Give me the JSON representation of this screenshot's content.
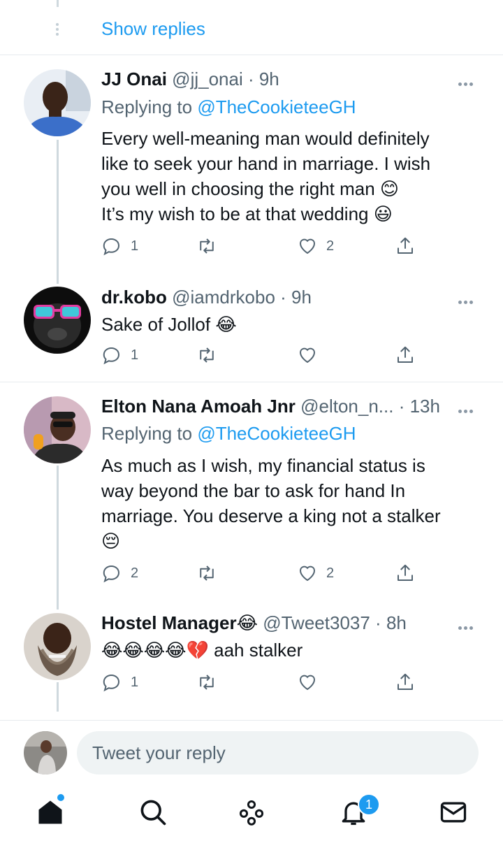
{
  "show_replies": "Show replies",
  "tweets": [
    {
      "name": "JJ Onai",
      "handle": "@jj_onai",
      "sep": " · ",
      "time": "9h",
      "replying_prefix": "Replying to ",
      "replying_to": "@TheCookieteeGH",
      "text_lines": [
        "Every well-meaning man would definitely",
        "like to seek your hand in marriage. I wish",
        "you well in choosing the right man 😊",
        "It’s my wish to be at that wedding 😃"
      ],
      "replies": "1",
      "retweets": "",
      "likes": "2"
    },
    {
      "name": "dr.kobo",
      "handle": "@iamdrkobo",
      "sep": " · ",
      "time": "9h",
      "text_lines": [
        "Sake of Jollof 😂"
      ],
      "replies": "1",
      "retweets": "",
      "likes": ""
    },
    {
      "name": "Elton Nana Amoah Jnr",
      "handle": "@elton_n...",
      "sep": " · ",
      "time": "13h",
      "replying_prefix": "Replying to ",
      "replying_to": "@TheCookieteeGH",
      "text_lines": [
        "As much as I wish, my financial status is",
        "way beyond the bar to ask for hand In",
        "marriage. You deserve a king not a stalker",
        "😔"
      ],
      "replies": "2",
      "retweets": "",
      "likes": "2"
    },
    {
      "name": "Hostel Manager😂",
      "handle": "@Tweet3037",
      "sep": " · ",
      "time": "8h",
      "text_lines": [
        "😂😂😂😂💔  aah stalker"
      ],
      "replies": "1",
      "retweets": "",
      "likes": ""
    }
  ],
  "composer": {
    "placeholder": "Tweet your reply"
  },
  "tabbar": {
    "notifications_badge": "1"
  },
  "colors": {
    "accent": "#1d9bf0",
    "muted": "#536471",
    "text": "#0f1419"
  }
}
